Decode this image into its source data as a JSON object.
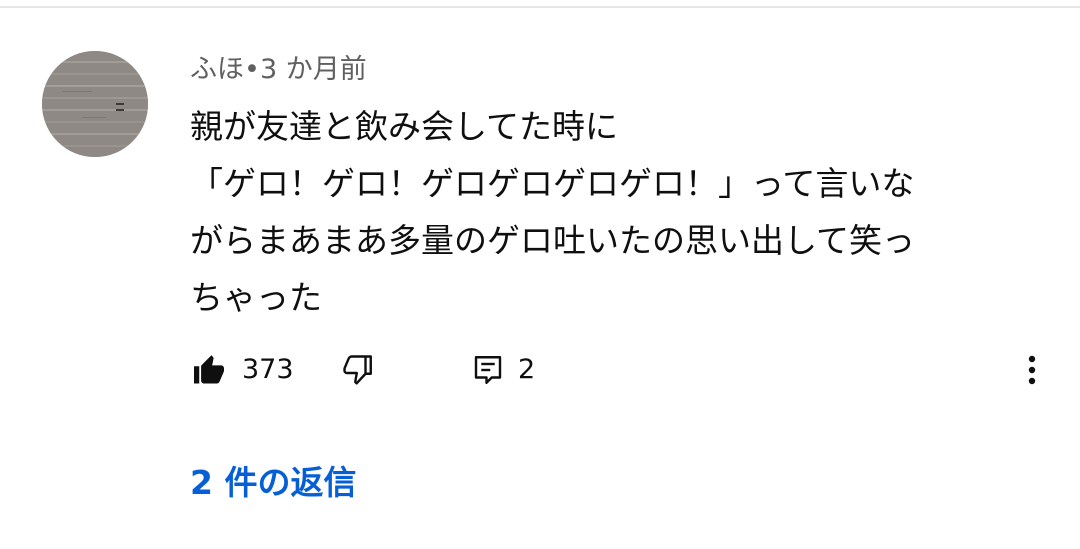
{
  "comment": {
    "author": "ふほ",
    "separator": "•",
    "time": "3 か月前",
    "text_lines": [
      "親が友達と飲み会してた時に",
      "「ゲロ！ゲロ！ゲロゲロゲロゲロ！」って言いな",
      "がらまあまあ多量のゲロ吐いたの思い出して笑っ",
      "ちゃった"
    ]
  },
  "actions": {
    "like_icon": "thumbs-up-filled-icon",
    "like_count": "373",
    "dislike_icon": "thumbs-down-outline-icon",
    "reply_icon": "comment-icon",
    "reply_count": "2",
    "more_icon": "more-vertical-icon"
  },
  "replies": {
    "label": "2 件の返信"
  },
  "colors": {
    "meta_text": "#606060",
    "body_text": "#0f0f0f",
    "link": "#065fd4",
    "divider": "#e5e5e5"
  }
}
